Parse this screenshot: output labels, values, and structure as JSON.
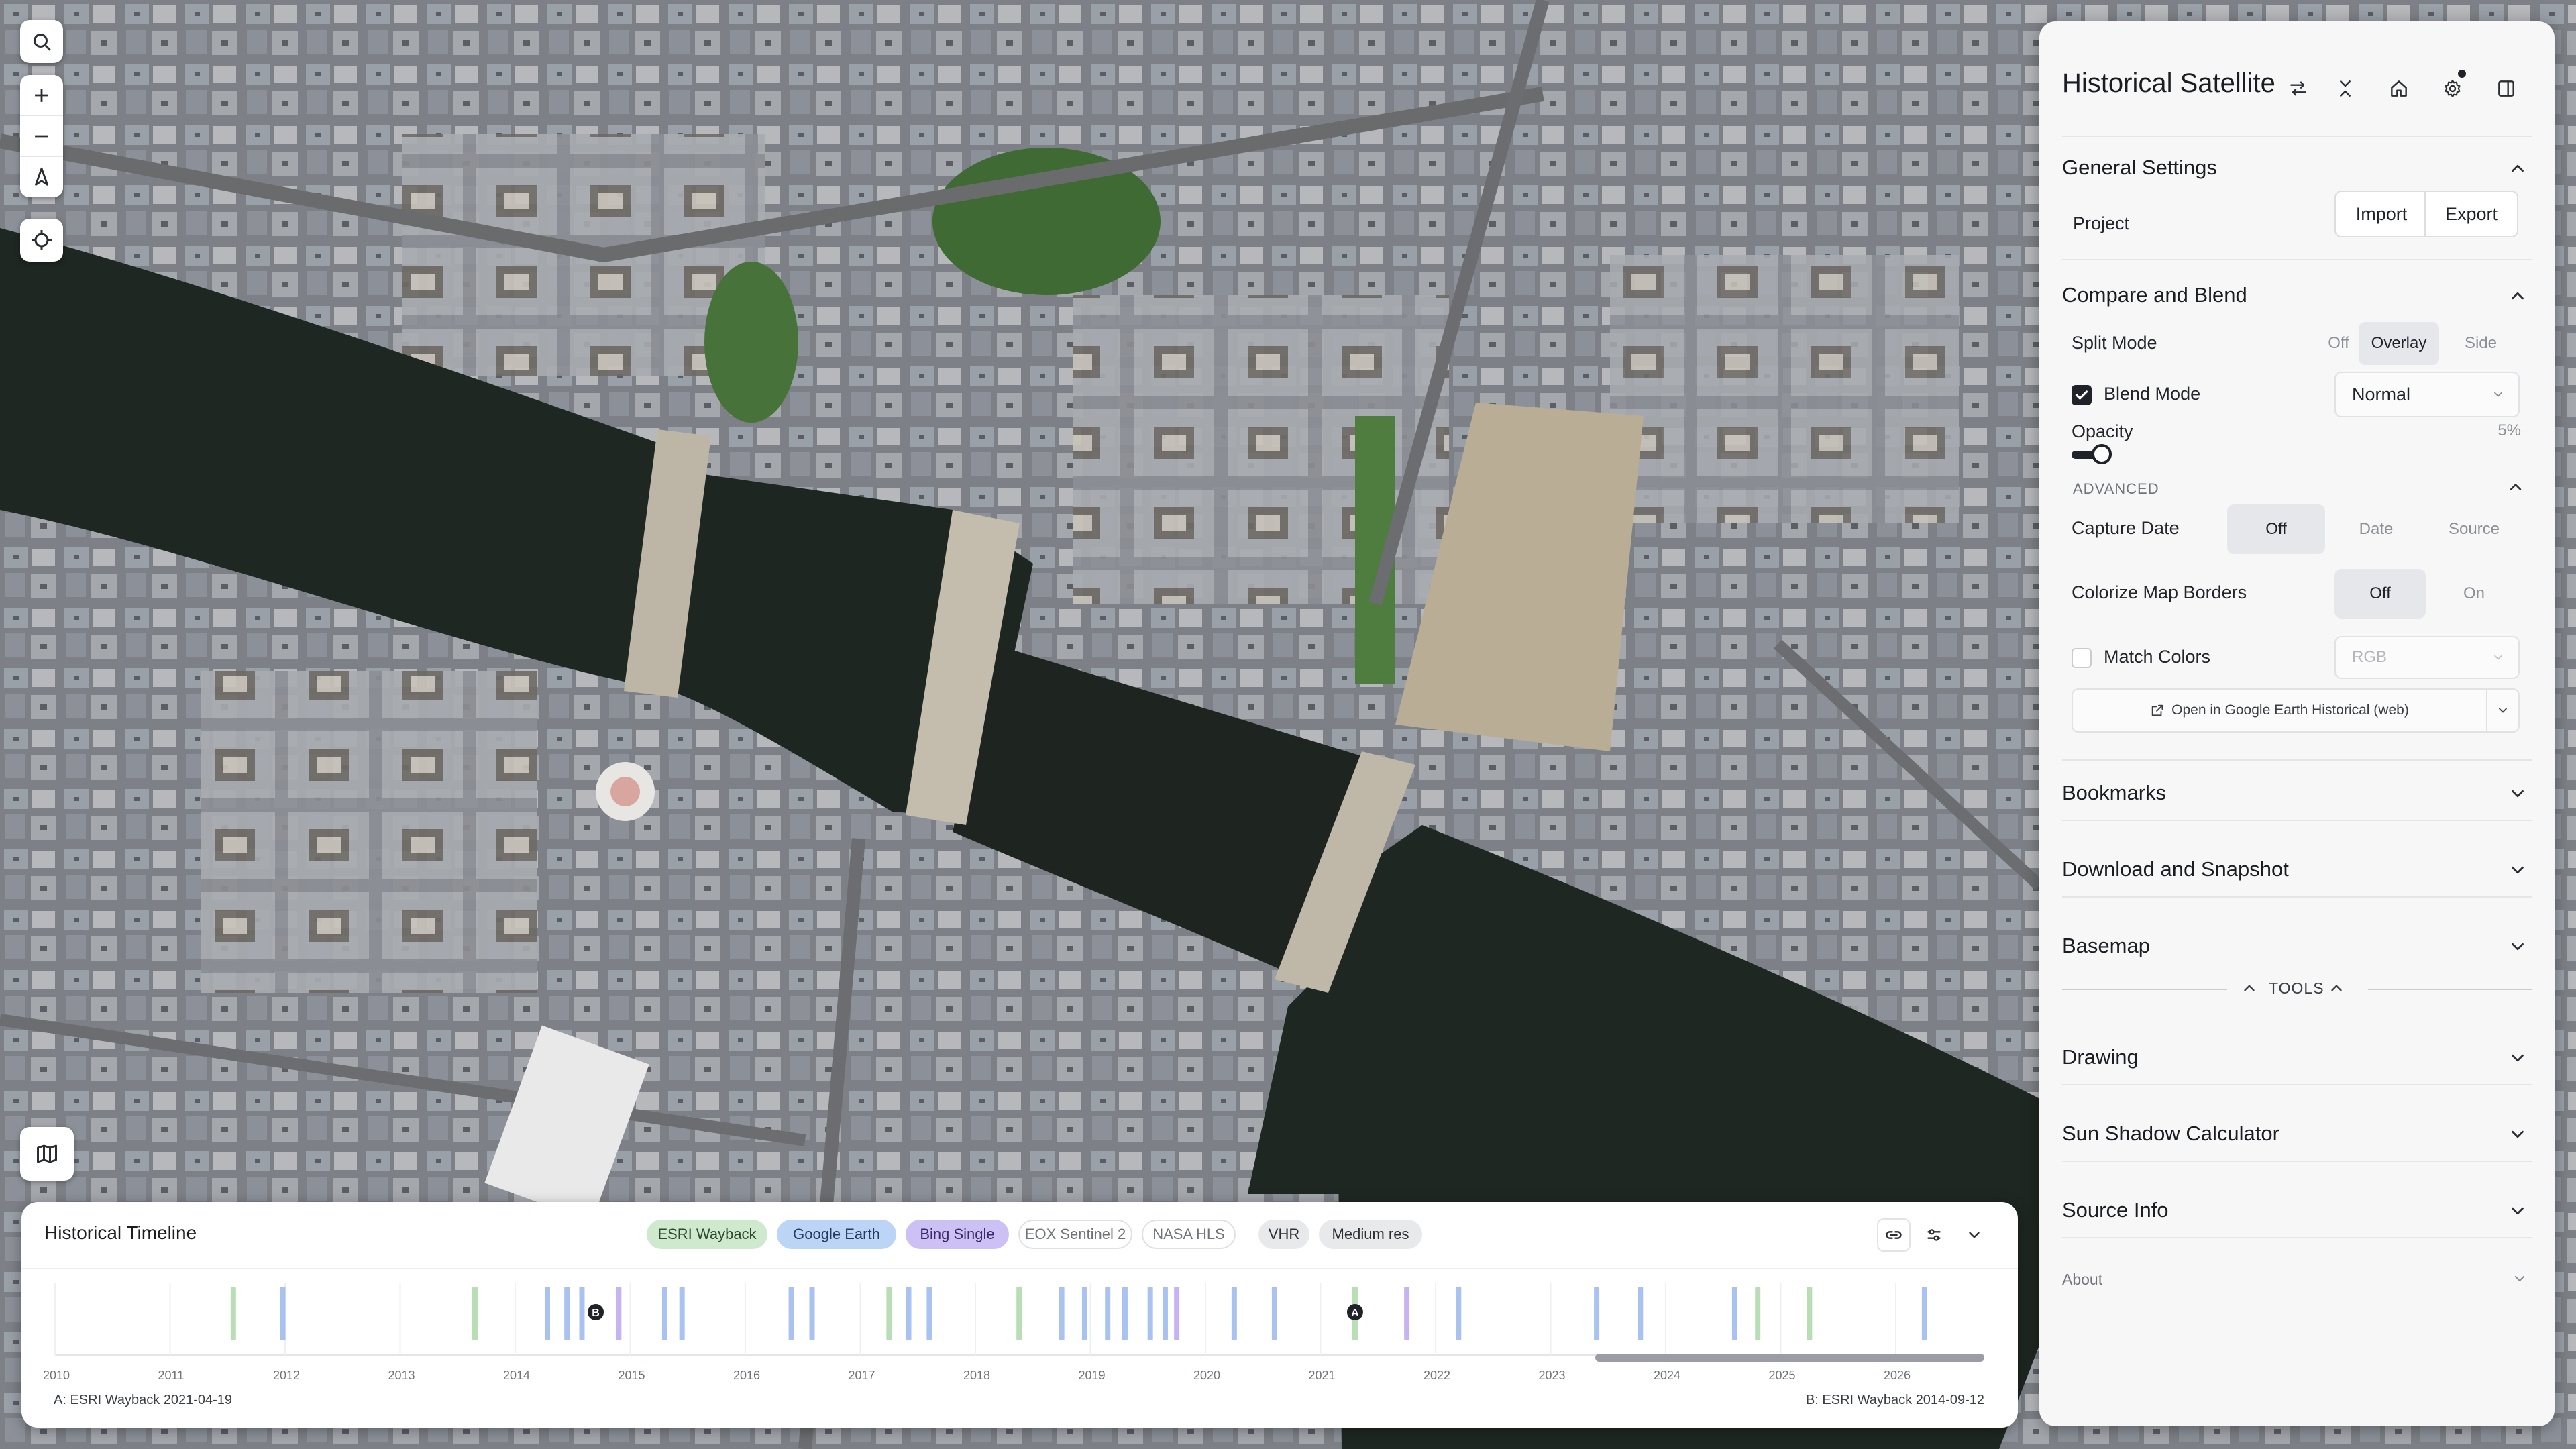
{
  "panel": {
    "title": "Historical Satellite",
    "general": {
      "title": "General Settings",
      "project_label": "Project",
      "import_label": "Import",
      "export_label": "Export"
    },
    "compare": {
      "title": "Compare and Blend",
      "split_mode_label": "Split Mode",
      "split_options": [
        "Off",
        "Overlay",
        "Side"
      ],
      "split_selected": "Overlay",
      "blend_mode_label": "Blend Mode",
      "blend_mode_checked": true,
      "blend_mode_value": "Normal",
      "opacity_label": "Opacity",
      "opacity_value_text": "5%",
      "opacity_fraction": 0.05,
      "advanced_label": "ADVANCED",
      "capture_date_label": "Capture Date",
      "capture_options": [
        "Off",
        "Date",
        "Source"
      ],
      "capture_selected": "Off",
      "colorize_label": "Colorize Map Borders",
      "colorize_options": [
        "Off",
        "On"
      ],
      "colorize_selected": "Off",
      "match_colors_label": "Match Colors",
      "match_colors_checked": false,
      "match_colors_value": "RGB",
      "open_ge_label": "Open in Google Earth Historical (web)"
    },
    "sections": {
      "bookmarks": "Bookmarks",
      "download": "Download and Snapshot",
      "basemap": "Basemap",
      "tools_label": "TOOLS",
      "drawing": "Drawing",
      "sun_shadow": "Sun Shadow Calculator",
      "source_info": "Source Info",
      "about": "About"
    }
  },
  "timeline": {
    "title": "Historical Timeline",
    "chips": [
      {
        "label": "ESRI Wayback",
        "bg": "#cfe9cf",
        "fg": "#2e4a2e",
        "border": "#cfe9cf"
      },
      {
        "label": "Google Earth",
        "bg": "#bcd4f6",
        "fg": "#223a5f",
        "border": "#bcd4f6"
      },
      {
        "label": "Bing Single",
        "bg": "#cdc0f4",
        "fg": "#3a2a6a",
        "border": "#cdc0f4"
      },
      {
        "label": "EOX Sentinel 2",
        "bg": "#ffffff",
        "fg": "#6f747b",
        "border": "#dfe1e4"
      },
      {
        "label": "NASA HLS",
        "bg": "#ffffff",
        "fg": "#6f747b",
        "border": "#dfe1e4"
      },
      {
        "label": "VHR",
        "bg": "#e8e9eb",
        "fg": "#2b2f34",
        "border": "#e8e9eb"
      },
      {
        "label": "Medium res",
        "bg": "#e8e9eb",
        "fg": "#2b2f34",
        "border": "#e8e9eb"
      }
    ],
    "years": [
      "2010",
      "2011",
      "2012",
      "2013",
      "2014",
      "2015",
      "2016",
      "2017",
      "2018",
      "2019",
      "2020",
      "2021",
      "2022",
      "2023",
      "2024",
      "2025",
      "2026"
    ],
    "marker_a": "A",
    "marker_b": "B",
    "caption_a": "A: ESRI Wayback 2021-04-19",
    "caption_b": "B: ESRI Wayback 2014-09-12",
    "captures": [
      {
        "year": 2011.55,
        "src": "esri"
      },
      {
        "year": 2011.98,
        "src": "google"
      },
      {
        "year": 2013.65,
        "src": "esri"
      },
      {
        "year": 2014.28,
        "src": "google"
      },
      {
        "year": 2014.45,
        "src": "google"
      },
      {
        "year": 2014.58,
        "src": "google"
      },
      {
        "year": 2014.9,
        "src": "bing"
      },
      {
        "year": 2015.3,
        "src": "google"
      },
      {
        "year": 2015.45,
        "src": "google"
      },
      {
        "year": 2016.4,
        "src": "google"
      },
      {
        "year": 2016.58,
        "src": "google"
      },
      {
        "year": 2017.25,
        "src": "esri"
      },
      {
        "year": 2017.42,
        "src": "google"
      },
      {
        "year": 2017.6,
        "src": "google"
      },
      {
        "year": 2018.38,
        "src": "esri"
      },
      {
        "year": 2018.75,
        "src": "google"
      },
      {
        "year": 2018.95,
        "src": "google"
      },
      {
        "year": 2019.15,
        "src": "google"
      },
      {
        "year": 2019.3,
        "src": "google"
      },
      {
        "year": 2019.52,
        "src": "google"
      },
      {
        "year": 2019.65,
        "src": "google"
      },
      {
        "year": 2019.75,
        "src": "bing"
      },
      {
        "year": 2020.25,
        "src": "google"
      },
      {
        "year": 2020.6,
        "src": "google"
      },
      {
        "year": 2021.3,
        "src": "esri"
      },
      {
        "year": 2021.75,
        "src": "bing"
      },
      {
        "year": 2022.2,
        "src": "google"
      },
      {
        "year": 2023.4,
        "src": "google"
      },
      {
        "year": 2023.78,
        "src": "google"
      },
      {
        "year": 2024.6,
        "src": "google"
      },
      {
        "year": 2024.8,
        "src": "esri"
      },
      {
        "year": 2025.25,
        "src": "esri"
      },
      {
        "year": 2026.25,
        "src": "google"
      }
    ],
    "marker_a_year": 2021.3,
    "marker_b_year": 2014.7,
    "colors": {
      "esri": "#b9deb5",
      "google": "#a9c2f0",
      "bing": "#c6b4f2"
    }
  },
  "map_controls": {
    "search": "search-icon",
    "zoom_in": "plus-icon",
    "zoom_out": "minus-icon",
    "compass": "compass-icon",
    "locate": "crosshair-icon",
    "layers": "map-icon"
  }
}
